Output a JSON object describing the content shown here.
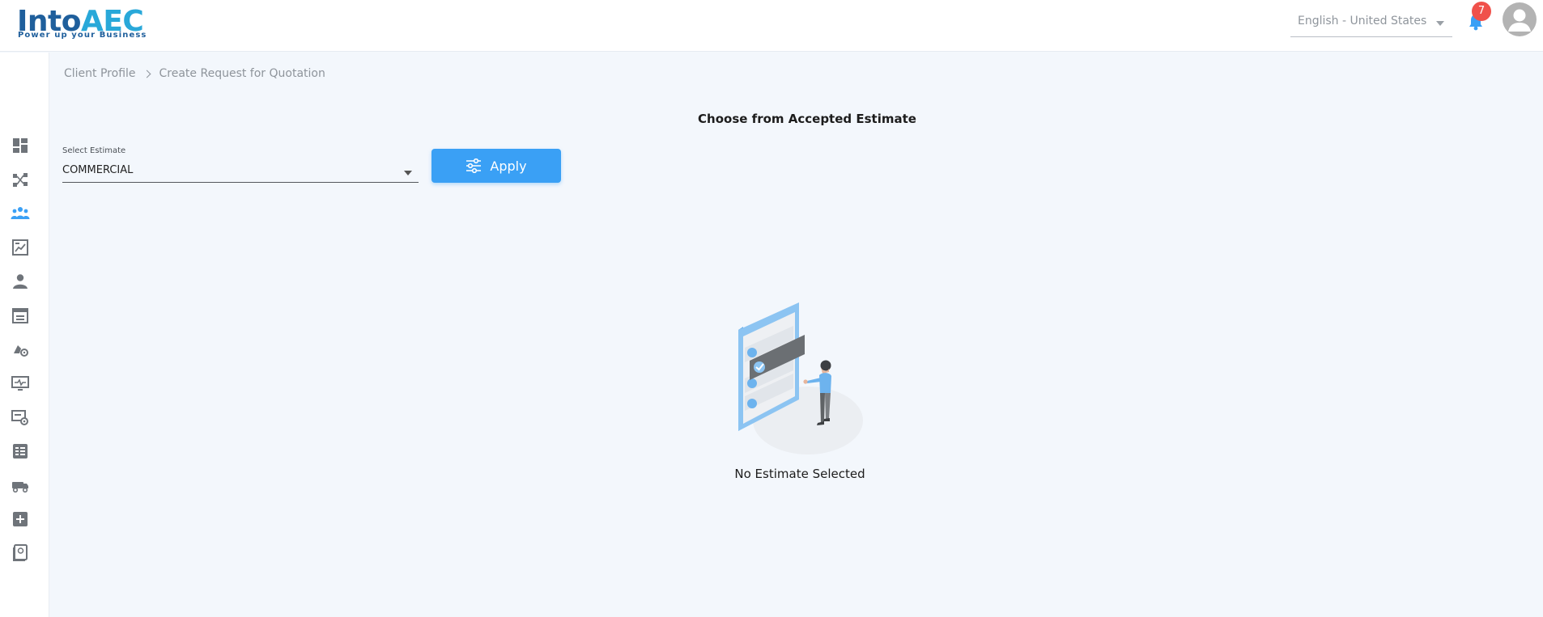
{
  "header": {
    "logo": {
      "brand": "IntoAEC",
      "brand_prefix": "Into",
      "brand_suffix": "AEC",
      "tagline": "Power up your Business"
    },
    "language": {
      "value": "English - United States"
    },
    "notifications": {
      "count": "7",
      "icon": "bell-icon"
    },
    "user_avatar_icon": "user-avatar-icon"
  },
  "sidebar": {
    "items": [
      {
        "id": "dashboard",
        "icon": "dashboard-icon",
        "active": false
      },
      {
        "id": "projects",
        "icon": "project-network-icon",
        "active": false
      },
      {
        "id": "clients",
        "icon": "people-group-icon",
        "active": true
      },
      {
        "id": "reports",
        "icon": "report-chart-icon",
        "active": false
      },
      {
        "id": "users",
        "icon": "user-icon",
        "active": false
      },
      {
        "id": "calendar",
        "icon": "calendar-icon",
        "active": false
      },
      {
        "id": "equipment",
        "icon": "equipment-icon",
        "active": false
      },
      {
        "id": "monitor",
        "icon": "monitor-pulse-icon",
        "active": false
      },
      {
        "id": "settings-tools",
        "icon": "tools-gear-icon",
        "active": false
      },
      {
        "id": "table-list",
        "icon": "table-list-icon",
        "active": false
      },
      {
        "id": "vehicle",
        "icon": "vehicle-icon",
        "active": false
      },
      {
        "id": "add",
        "icon": "add-square-icon",
        "active": false
      },
      {
        "id": "billing",
        "icon": "billing-book-icon",
        "active": false
      }
    ]
  },
  "breadcrumb": {
    "items": [
      "Client Profile",
      "Create Request for Quotation"
    ]
  },
  "main": {
    "title": "Choose from Accepted Estimate",
    "select": {
      "label": "Select Estimate",
      "value": "COMMERCIAL"
    },
    "apply_button": {
      "label": "Apply",
      "icon": "sliders-icon"
    },
    "empty_state": {
      "text": "No Estimate Selected",
      "illustration": "checklist-person-illustration"
    }
  },
  "colors": {
    "primary": "#3aa0f5",
    "background": "#f3f7fc",
    "badge": "#f0514b",
    "logo_dark": "#1f5f9c",
    "logo_light": "#29a8d9",
    "icon_inactive": "#6f747a"
  }
}
